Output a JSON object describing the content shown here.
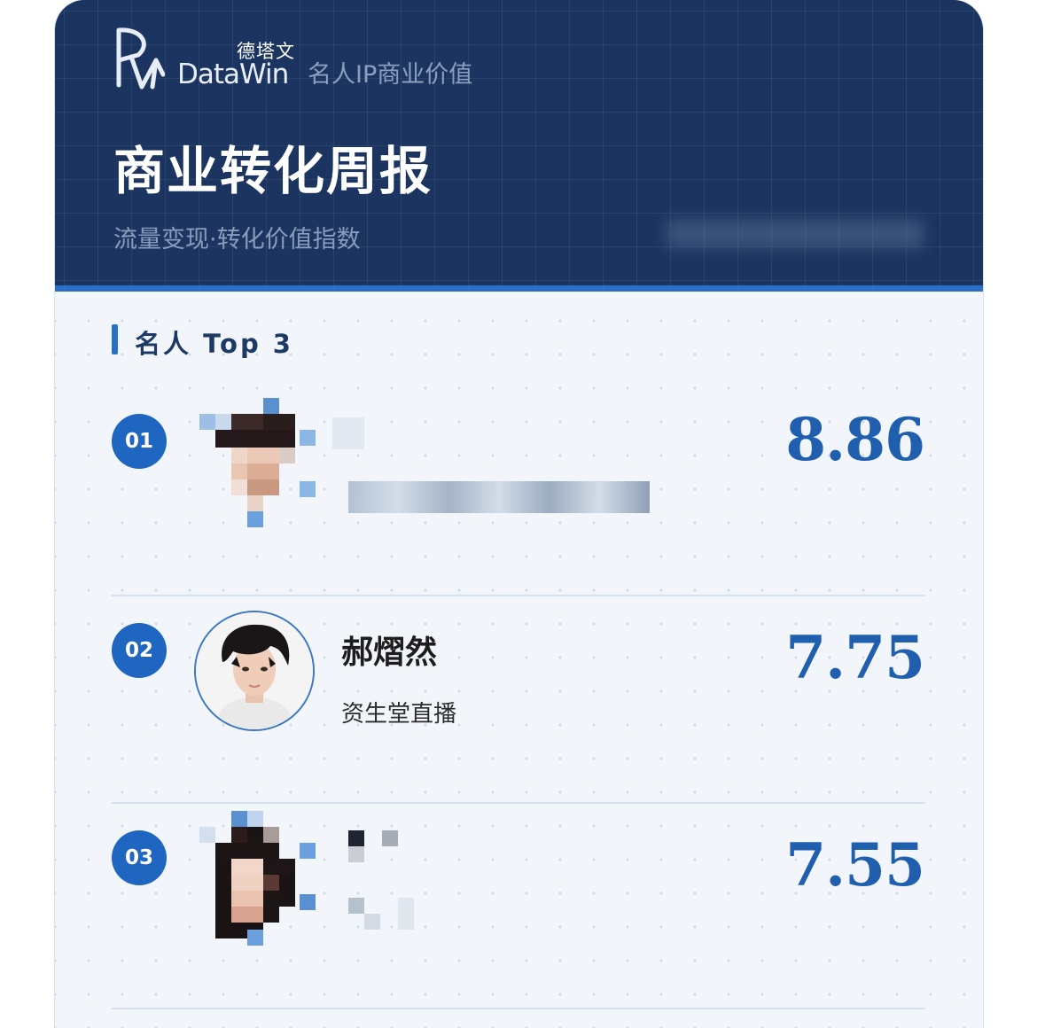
{
  "header": {
    "brand_cn": "德塔文",
    "brand_en": "DataWin",
    "brand_subtitle": "名人IP商业价值",
    "title": "商业转化周报",
    "subtitle": "流量变现·转化价值指数"
  },
  "section": {
    "title": "名人 Top 3"
  },
  "entries": [
    {
      "rank": "01",
      "name": "",
      "subtitle": "",
      "score": "8.86"
    },
    {
      "rank": "02",
      "name": "郝熠然",
      "subtitle": "资生堂直播",
      "score": "7.75"
    },
    {
      "rank": "03",
      "name": "",
      "subtitle": "",
      "score": "7.55"
    }
  ],
  "colors": {
    "header_bg": "#1b3560",
    "accent": "#2a6fc6",
    "score": "#1f5fae",
    "rank_badge": "#1f66c1"
  }
}
